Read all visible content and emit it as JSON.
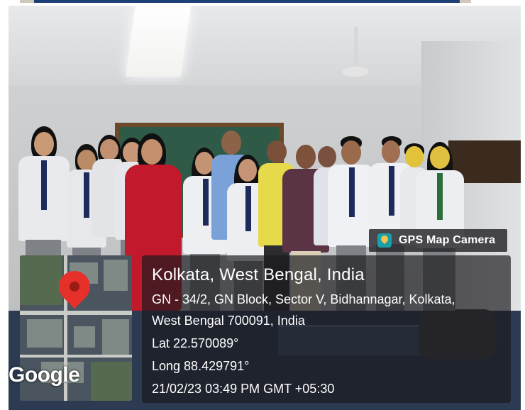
{
  "watermark": {
    "app_name": "GPS Map Camera",
    "icon": "map-pin-icon"
  },
  "location": {
    "title": "Kolkata, West Bengal, India",
    "address_line1": "GN - 34/2, GN Block, Sector V, Bidhannagar, Kolkata,",
    "address_line2": "West Bengal 700091, India",
    "latitude": "Lat 22.570089°",
    "longitude": "Long 88.429791°",
    "timestamp": "21/02/23 03:49 PM GMT +05:30"
  },
  "map": {
    "provider_logo": "Google",
    "marker_icon": "location-marker-icon",
    "marker_color": "#e5312a"
  },
  "colors": {
    "overlay_bg": "#1e1e23",
    "watermark_icon_bg": "#19a0a8"
  }
}
